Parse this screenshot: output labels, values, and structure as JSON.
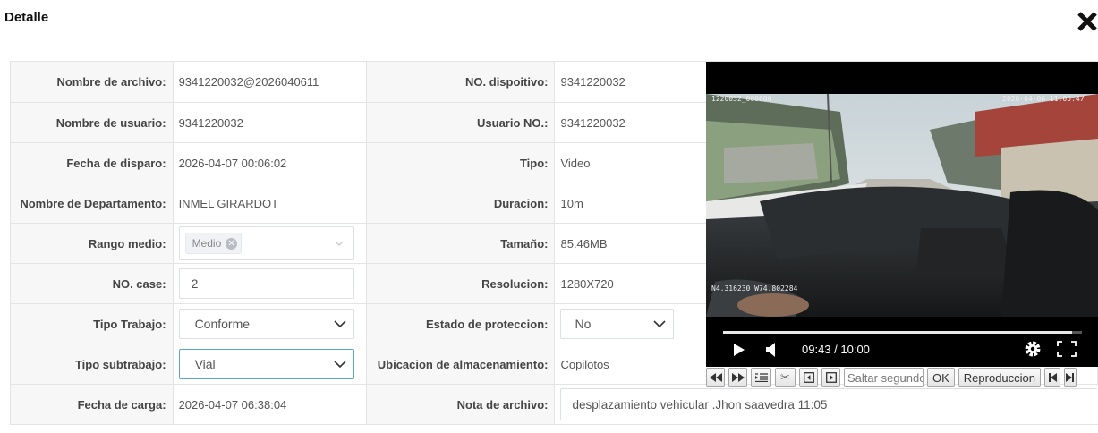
{
  "header": {
    "title": "Detalle"
  },
  "rows": [
    {
      "label1": "Nombre de archivo:",
      "value1": "9341220032@2026040611",
      "label2": "NO. dispoitivo:",
      "value2": "9341220032"
    },
    {
      "label1": "Nombre de usuario:",
      "value1": "9341220032",
      "label2": "Usuario NO.:",
      "value2": "9341220032"
    },
    {
      "label1": "Fecha de disparo:",
      "value1": "2026-04-07 00:06:02",
      "label2": "Tipo:",
      "value2": "Video"
    },
    {
      "label1": "Nombre de Departamento:",
      "value1": "INMEL GIRARDOT",
      "label2": "Duracion:",
      "value2": "10m"
    },
    {
      "label1": "Rango medio:",
      "value1": "Medio",
      "label2": "Tamaño:",
      "value2": "85.46MB"
    },
    {
      "label1": "NO. case:",
      "value1": "2",
      "label2": "Resolucion:",
      "value2": "1280X720"
    },
    {
      "label1": "Tipo Trabajo:",
      "value1": "Conforme",
      "label2": "Estado de proteccion:",
      "value2": "No"
    },
    {
      "label1": "Tipo subtrabajo:",
      "value1": "Vial",
      "label2": "Ubicacion de almacenamiento:",
      "value2": "Copilotos"
    },
    {
      "label1": "Fecha de carga:",
      "value1": "2026-04-07 06:38:04",
      "label2": "Nota de archivo:",
      "value2": "desplazamiento vehicular .Jhon saavedra 11:05"
    }
  ],
  "player": {
    "osd_top_left": "1220032_000000",
    "osd_top_right": "2026-04-06 11:05:47",
    "osd_gps": "N4.316230 W74.802284",
    "time": "09:43 / 10:00",
    "progress": 0.9717
  },
  "toolbar": {
    "seek_placeholder": "Saltar segundos",
    "ok_label": "OK",
    "playback_label": "Reproduccion"
  }
}
